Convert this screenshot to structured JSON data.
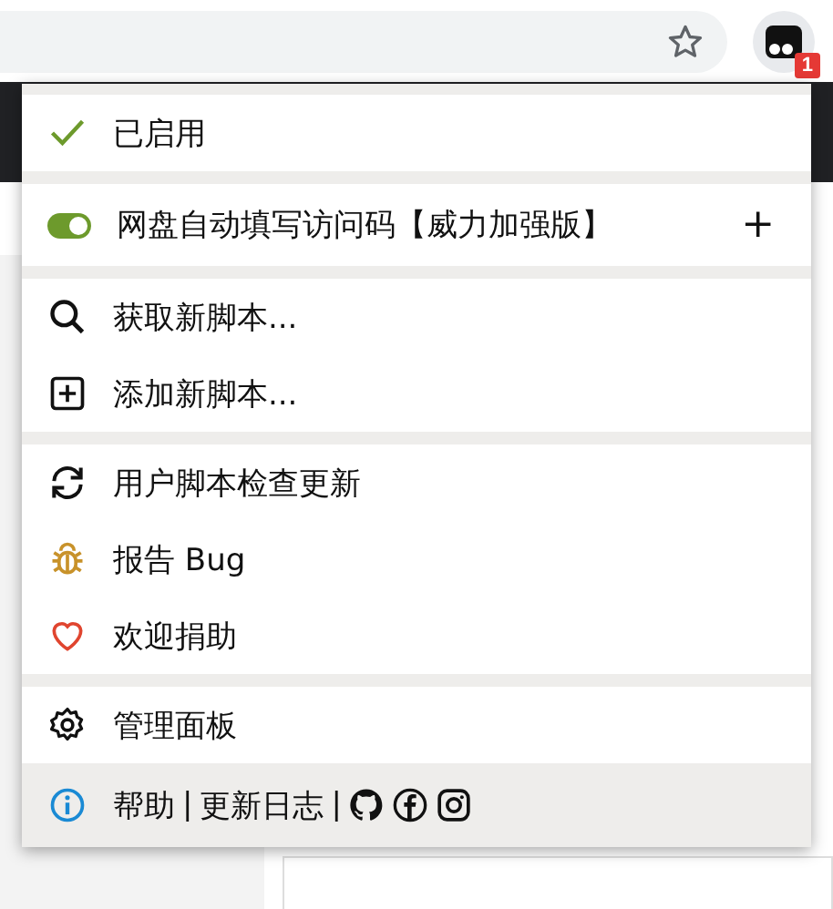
{
  "toolbar": {
    "badge": "1"
  },
  "menu": {
    "status": {
      "label": "已启用",
      "enabled": true
    },
    "scripts": [
      {
        "name": "网盘自动填写访问码【威力加强版】",
        "on": true,
        "action": "+"
      }
    ],
    "groups": [
      [
        {
          "kind": "search",
          "label": "获取新脚本..."
        },
        {
          "kind": "add",
          "label": "添加新脚本..."
        }
      ],
      [
        {
          "kind": "refresh",
          "label": "用户脚本检查更新"
        },
        {
          "kind": "bug",
          "label": "报告 Bug"
        },
        {
          "kind": "heart",
          "label": "欢迎捐助"
        }
      ],
      [
        {
          "kind": "gear",
          "label": "管理面板"
        }
      ]
    ],
    "footer": {
      "links": [
        "帮助",
        "更新日志"
      ],
      "separator": "|"
    }
  }
}
